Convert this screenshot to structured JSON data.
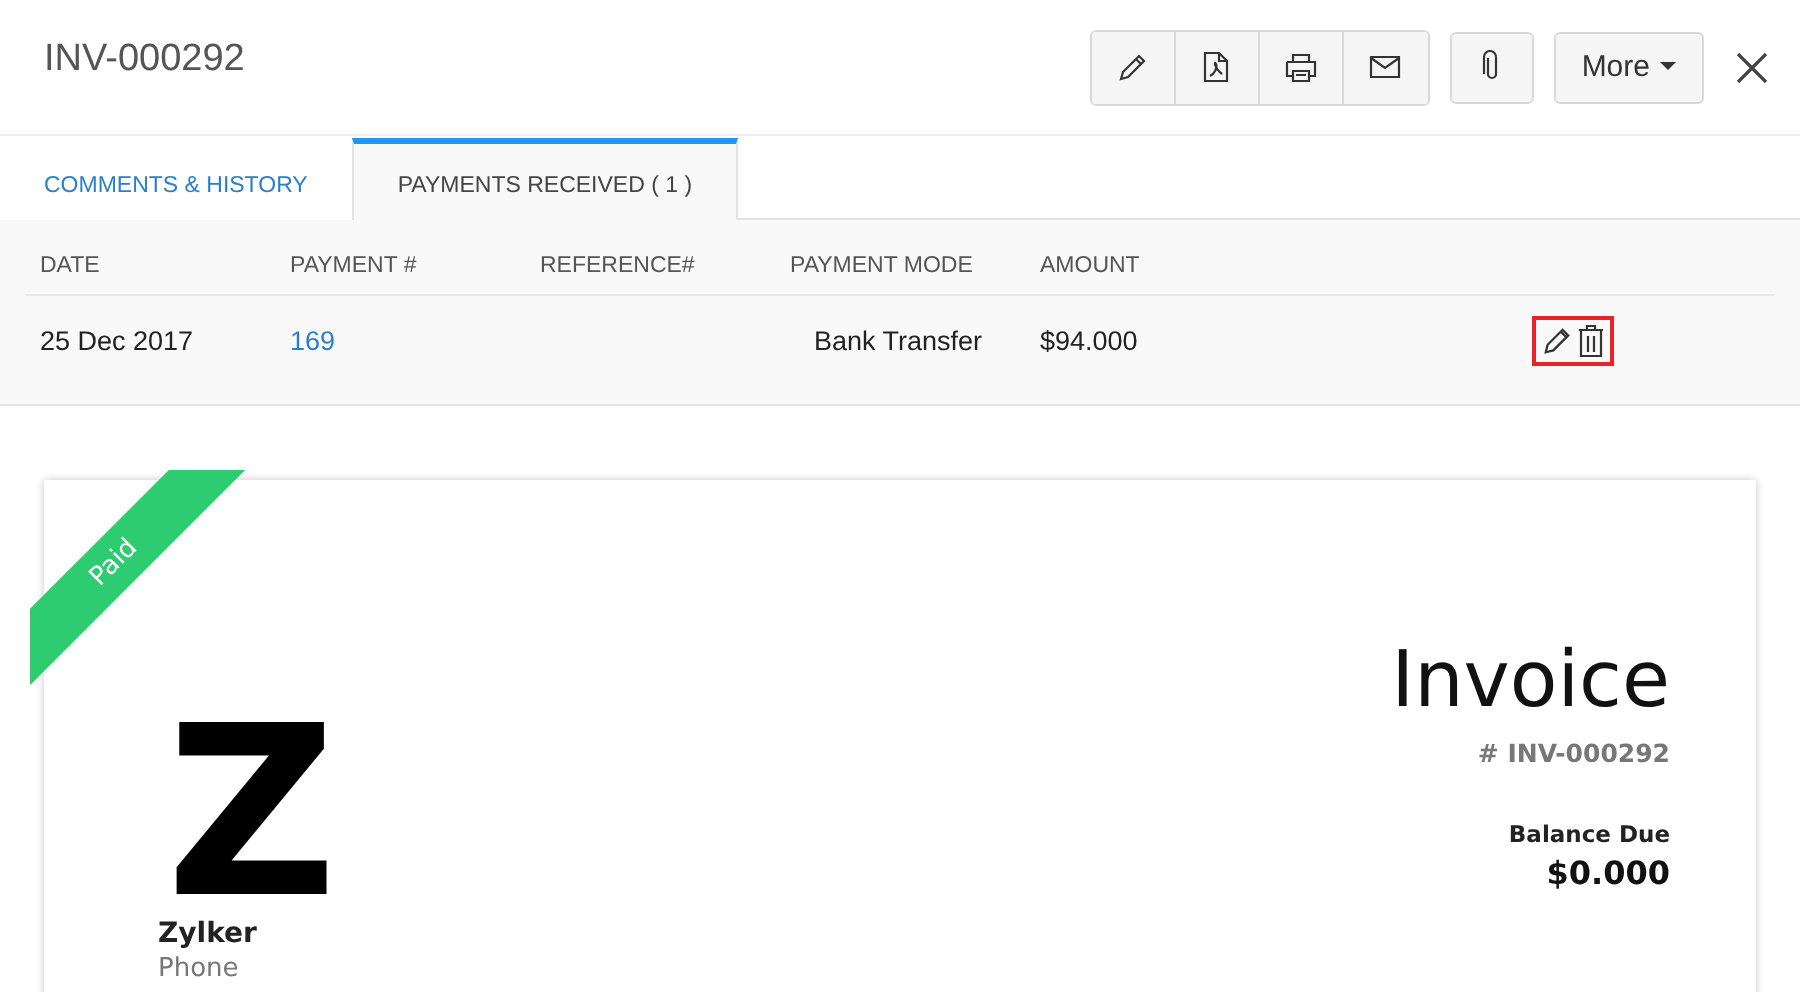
{
  "header": {
    "title": "INV-000292",
    "toolbar": [
      {
        "kind": "edit"
      },
      {
        "kind": "pdf"
      },
      {
        "kind": "print"
      },
      {
        "kind": "email"
      }
    ],
    "attach": {
      "kind": "attach"
    },
    "more": "More"
  },
  "tabs": [
    {
      "label": "COMMENTS & HISTORY",
      "selected": false
    },
    {
      "label": "PAYMENTS RECEIVED ( 1 )",
      "selected": true
    }
  ],
  "payments": {
    "columns": [
      "DATE",
      "PAYMENT #",
      "REFERENCE#",
      "PAYMENT MODE",
      "AMOUNT"
    ],
    "rows": [
      {
        "date": "25 Dec 2017",
        "payment_number": "169",
        "mode": "Bank Transfer",
        "amount": "$94.000",
        "actions_highlighted": true
      }
    ]
  },
  "invoice": {
    "status": "Paid",
    "logo": "Z",
    "company": "Zylker",
    "phone_label": "Phone",
    "title": "Invoice",
    "number": "# INV-000292",
    "balance_label": "Balance Due",
    "balance": "$0.000"
  }
}
